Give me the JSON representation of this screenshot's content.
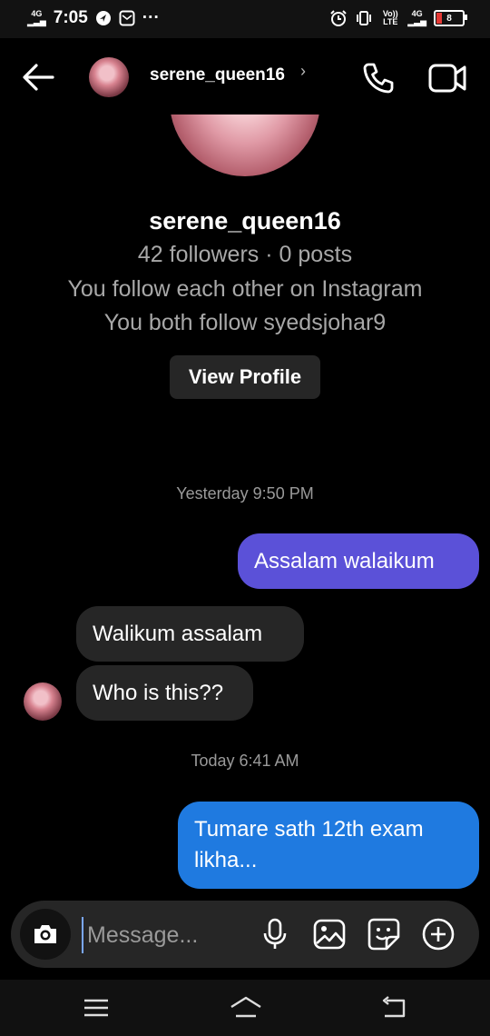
{
  "status_bar": {
    "time": "7:05",
    "network_left": "4G",
    "volte": "Vo)) LTE",
    "network_right": "4G",
    "battery": "8"
  },
  "header": {
    "username": "serene_queen16"
  },
  "profile": {
    "name": "serene_queen16",
    "stats": "42 followers · 0 posts",
    "mutual": "You follow each other on Instagram",
    "both_follow": "You both follow syedsjohar9",
    "view_profile_label": "View Profile"
  },
  "messages": [
    {
      "type": "timestamp",
      "text": "Yesterday 9:50 PM"
    },
    {
      "type": "outgoing",
      "text": "Assalam walaikum"
    },
    {
      "type": "incoming",
      "text": "Walikum assalam"
    },
    {
      "type": "incoming",
      "text": "Who is this??"
    },
    {
      "type": "timestamp",
      "text": "Today 6:41 AM"
    },
    {
      "type": "outgoing",
      "text": "Tumare sath 12th exam likha..."
    }
  ],
  "composer": {
    "placeholder": "Message..."
  },
  "colors": {
    "outgoing_purple": "#5b51d8",
    "outgoing_blue": "#1f7ae0",
    "incoming": "#262626",
    "background": "#000000"
  }
}
